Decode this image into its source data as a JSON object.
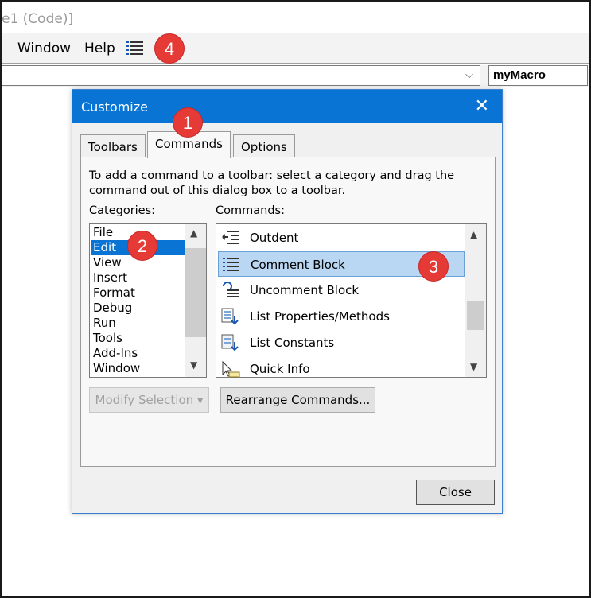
{
  "window": {
    "title": "e1 (Code)]"
  },
  "menubar": {
    "items": [
      {
        "label": "Window",
        "access": "W"
      },
      {
        "label": "Help",
        "access": "H"
      }
    ],
    "comment_block_icon": "comment-block-icon"
  },
  "codebar": {
    "object_combo": "",
    "procedure_combo": "myMacro"
  },
  "annotations": [
    "1",
    "2",
    "3",
    "4"
  ],
  "colors": {
    "accent": "#0a74d4",
    "badge": "#e53a35",
    "selection": "#b9d6f2"
  },
  "dialog": {
    "title": "Customize",
    "close_glyph": "✕",
    "tabs": [
      {
        "label": "Toolbars",
        "active": false
      },
      {
        "label": "Commands",
        "active": true
      },
      {
        "label": "Options",
        "active": false
      }
    ],
    "instructions": "To add a command to a toolbar: select a category and drag the command out of this dialog box to a toolbar.",
    "categories_label": "Categories:",
    "commands_label": "Commands:",
    "categories": [
      "File",
      "Edit",
      "View",
      "Insert",
      "Format",
      "Debug",
      "Run",
      "Tools",
      "Add-Ins",
      "Window"
    ],
    "selected_category": "Edit",
    "commands": [
      {
        "label": "Outdent",
        "icon": "outdent-icon"
      },
      {
        "label": "Comment Block",
        "icon": "comment-block-icon",
        "selected": true
      },
      {
        "label": "Uncomment Block",
        "icon": "uncomment-block-icon"
      },
      {
        "label": "List Properties/Methods",
        "icon": "list-properties-icon"
      },
      {
        "label": "List Constants",
        "icon": "list-constants-icon"
      },
      {
        "label": "Quick Info",
        "icon": "quick-info-icon"
      }
    ],
    "buttons": {
      "modify_selection": "Modify Selection ▾",
      "rearrange_commands": "Rearrange Commands...",
      "close": "Close"
    }
  }
}
